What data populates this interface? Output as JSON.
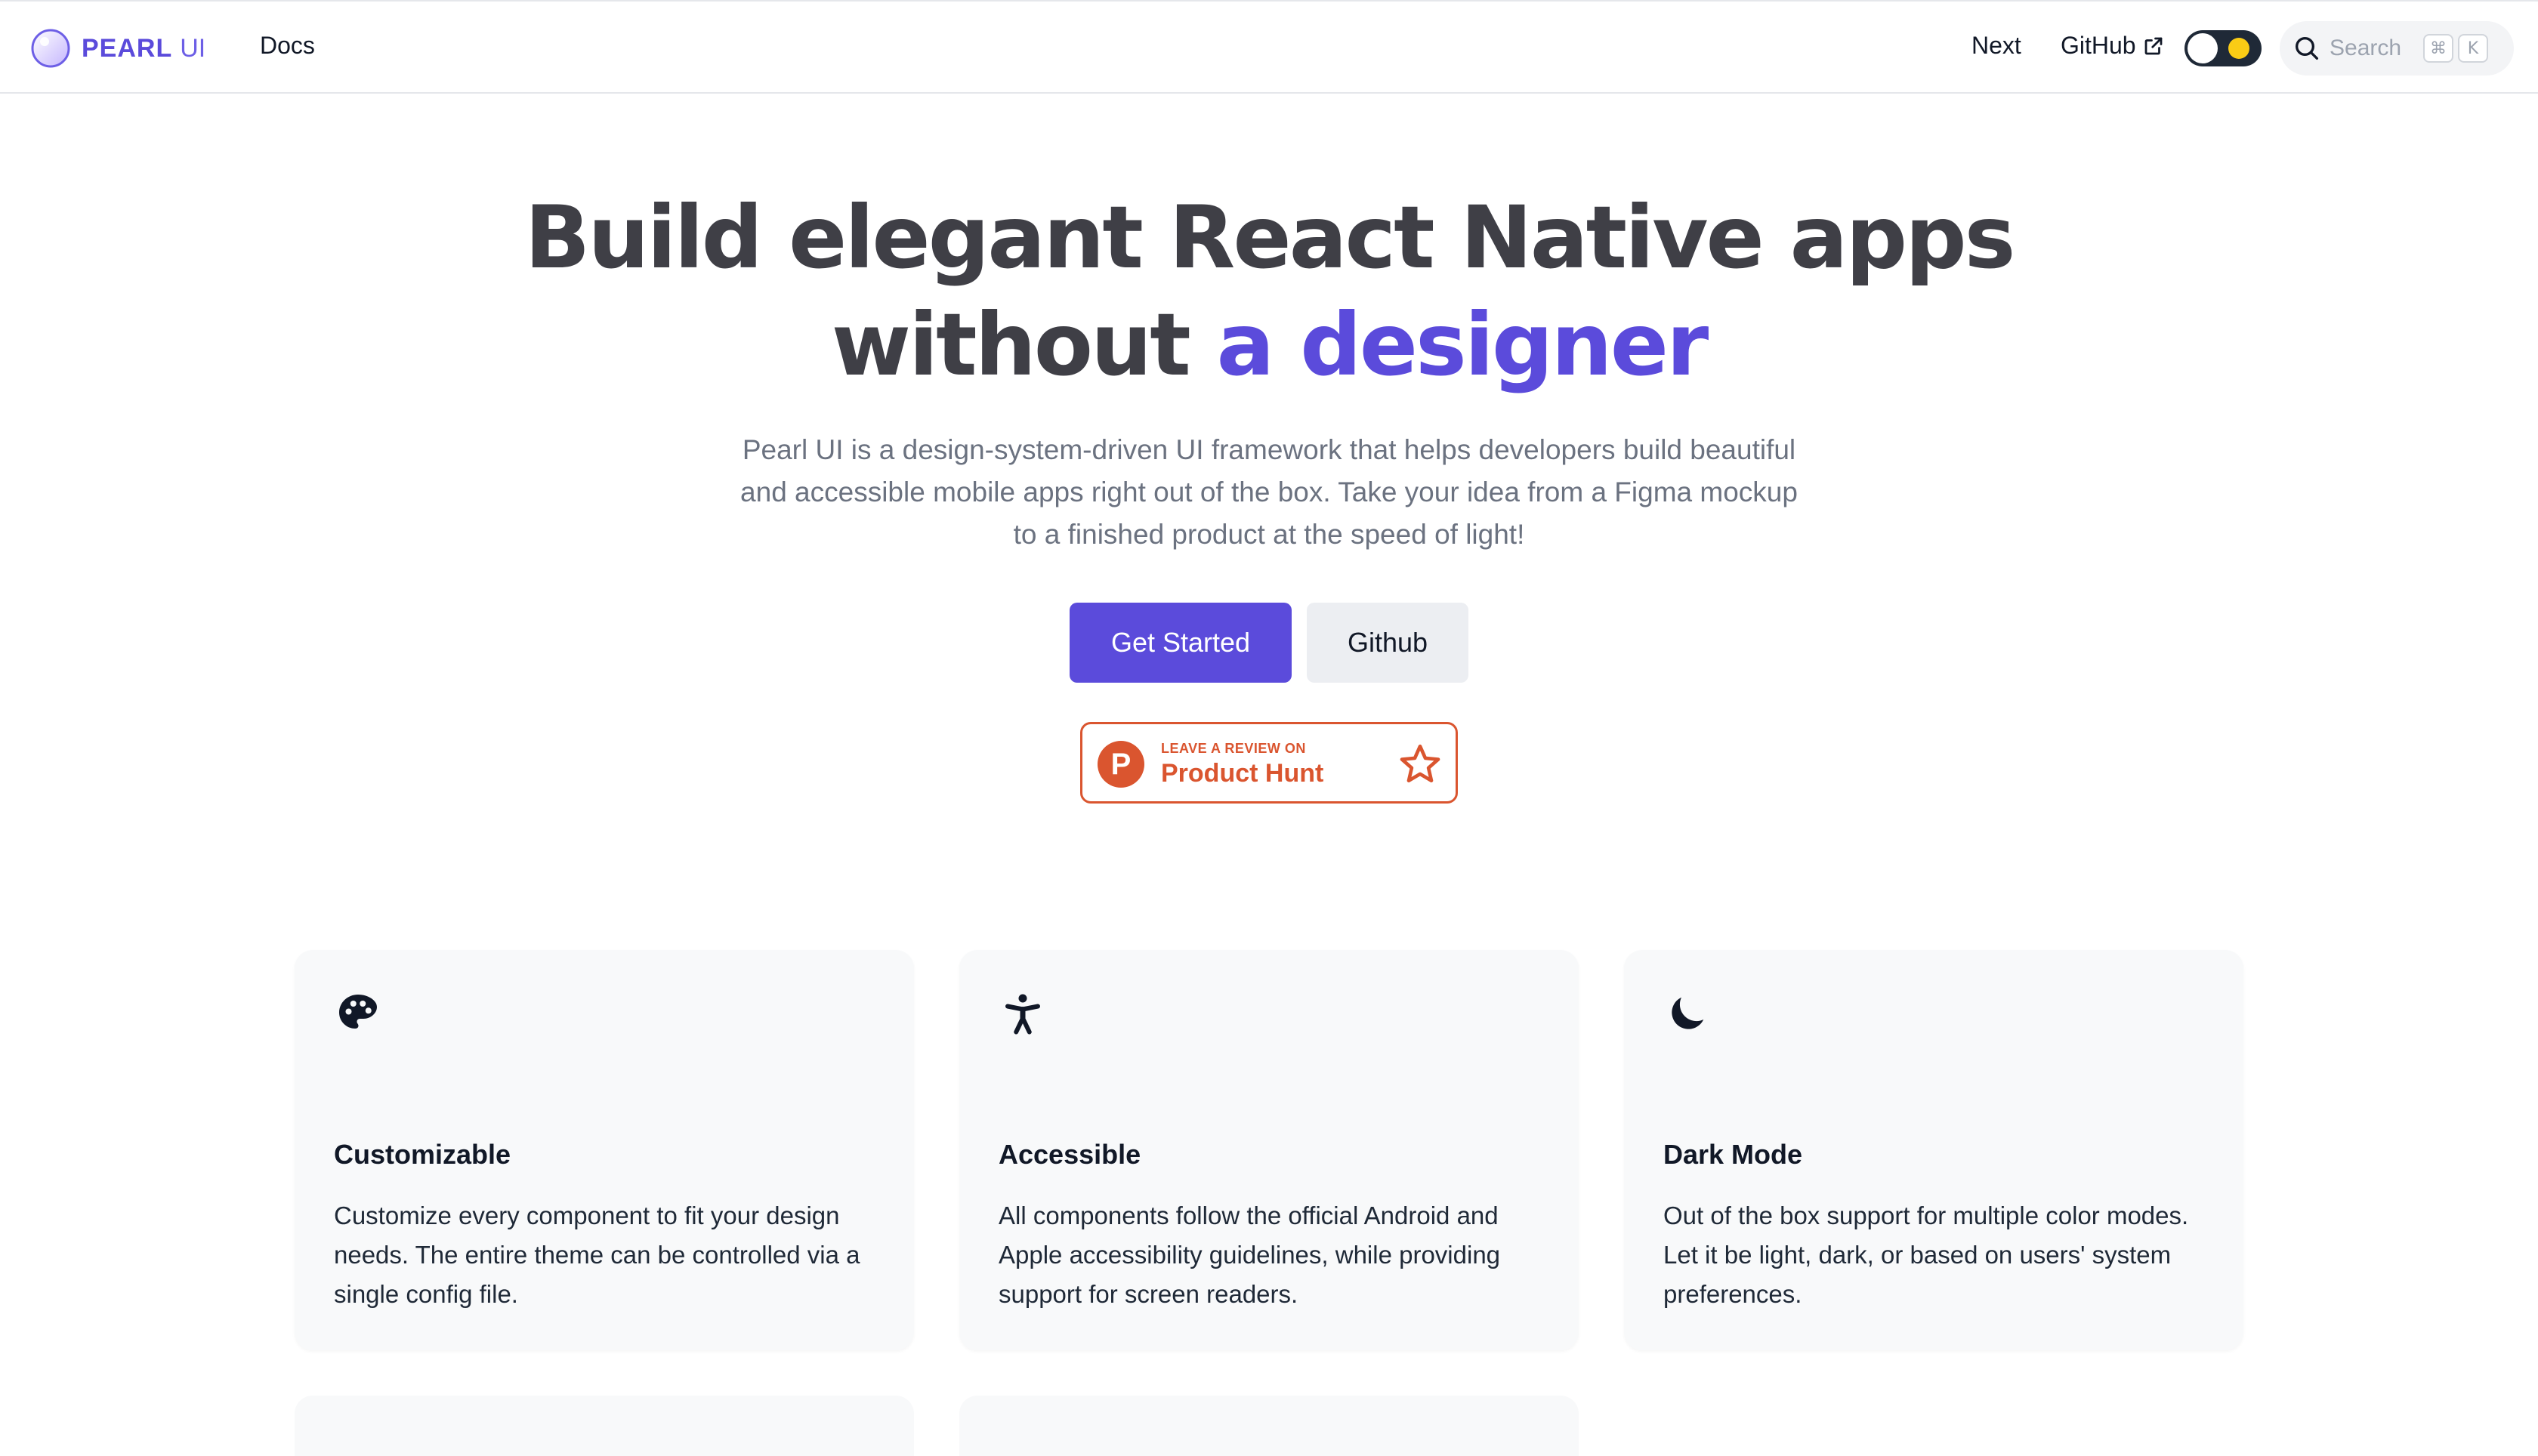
{
  "navbar": {
    "brand_name": "PEARL",
    "brand_suffix": "UI",
    "docs_label": "Docs",
    "next_label": "Next",
    "github_label": "GitHub",
    "search_placeholder": "Search",
    "search_shortcut_modifier": "⌘",
    "search_shortcut_key": "K"
  },
  "hero": {
    "title_line1": "Build elegant React Native apps",
    "title_line2_plain": "without ",
    "title_line2_accent": "a designer",
    "subtitle": "Pearl UI is a design-system-driven UI framework that helps developers build beautiful and accessible mobile apps right out of the box. Take your idea from a Figma mockup to a finished product at the speed of light!",
    "primary_cta": "Get Started",
    "secondary_cta": "Github",
    "product_hunt": {
      "small_text": "LEAVE A REVIEW ON",
      "big_text": "Product Hunt",
      "logo_letter": "P"
    }
  },
  "features": [
    {
      "icon": "palette-icon",
      "title": "Customizable",
      "description": "Customize every component to fit your design needs. The entire theme can be controlled via a single config file."
    },
    {
      "icon": "accessibility-icon",
      "title": "Accessible",
      "description": "All components follow the official Android and Apple accessibility guidelines, while providing support for screen readers."
    },
    {
      "icon": "moon-icon",
      "title": "Dark Mode",
      "description": "Out of the box support for multiple color modes. Let it be light, dark, or based on users' system preferences."
    }
  ],
  "colors": {
    "brand": "#5b4bdb",
    "heading": "#3f3f46",
    "product_hunt": "#da552f",
    "card_bg": "#f8f9fa"
  }
}
